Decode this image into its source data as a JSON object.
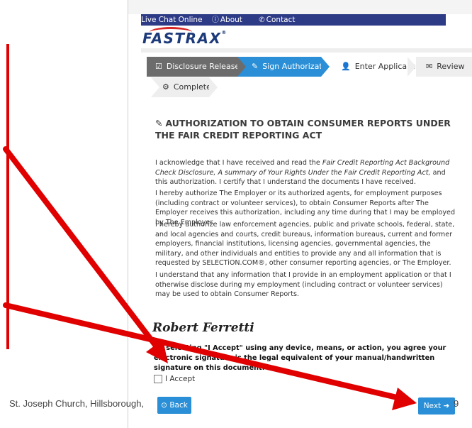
{
  "topbar": {
    "live_chat": "Live Chat Online",
    "about": "About",
    "contact": "Contact"
  },
  "logo": {
    "text": "FASTRAX",
    "tm": "®"
  },
  "steps": [
    {
      "label": "Disclosure Release",
      "icon": "check-square-icon"
    },
    {
      "label": "Sign Authorization",
      "icon": "edit-icon"
    },
    {
      "label": "Enter Applicant Info",
      "icon": "user-icon"
    },
    {
      "label": "Review",
      "icon": "envelope-icon"
    },
    {
      "label": "Complete",
      "icon": "cogs-icon"
    }
  ],
  "content": {
    "heading": "AUTHORIZATION TO OBTAIN CONSUMER REPORTS UNDER THE FAIR CREDIT REPORTING ACT",
    "p1_a": "I acknowledge that I have received and read the ",
    "p1_i": "Fair Credit Reporting Act Background Check Disclosure, A summary of Your Rights Under the Fair Credit Reporting Act,",
    "p1_b": " and this authorization. I certify that I understand the documents I have received.",
    "p2": "I hereby authorize The Employer or its authorized agents, for employment purposes (including contract or volunteer services), to obtain Consumer Reports after The Employer receives this authorization, including any time during that I may be employed by The Employer.",
    "p3": "I hereby authorize law enforcement agencies, public and private schools, federal, state, and local agencies and courts, credit bureaus, information bureaus, current and former employers, financial institutions, licensing agencies, governmental agencies, the military, and other individuals and entities to provide any and all information that is requested by SELECTiON.COM®, other consumer reporting agencies, or The Employer.",
    "p4": "I understand that any information that I provide in an employment application or that I otherwise disclose during my employment (including contract or volunteer services) may be used to obtain Consumer Reports."
  },
  "signature": {
    "name": "Robert Ferretti",
    "note": "By selecting \"I Accept\" using any device, means, or action, you agree your electronic signature is the legal equivalent of your manual/handwritten signature on this document."
  },
  "accept_label": "I Accept",
  "buttons": {
    "back": "Back",
    "next": "Next"
  },
  "footer": {
    "text": "St. Joseph Church, Hillsborough,",
    "page": "9"
  },
  "colors": {
    "nav": "#2d3a86",
    "accent": "#2a8fd6",
    "annotation_red": "#e00000"
  }
}
